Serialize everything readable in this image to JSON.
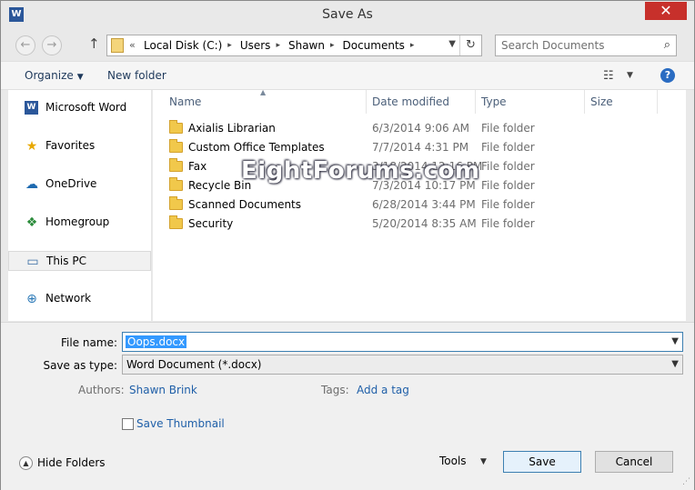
{
  "window": {
    "title": "Save As",
    "app_icon": "W",
    "close_label": "✕"
  },
  "nav": {
    "back_icon": "arrow-left-icon",
    "forward_icon": "arrow-right-icon",
    "up_icon": "arrow-up-icon",
    "crumb_overflow": "«",
    "breadcrumbs": [
      "Local Disk (C:)",
      "Users",
      "Shawn",
      "Documents"
    ],
    "search_placeholder": "Search Documents"
  },
  "toolbar": {
    "organize": "Organize",
    "new_folder": "New folder"
  },
  "sidebar": {
    "items": [
      {
        "label": "Microsoft Word",
        "icon": "word-icon"
      },
      {
        "label": "Favorites",
        "icon": "star-icon"
      },
      {
        "label": "OneDrive",
        "icon": "cloud-icon"
      },
      {
        "label": "Homegroup",
        "icon": "homegroup-icon"
      },
      {
        "label": "This PC",
        "icon": "computer-icon",
        "selected": true
      },
      {
        "label": "Network",
        "icon": "network-icon"
      }
    ]
  },
  "columns": {
    "name": "Name",
    "date": "Date modified",
    "type": "Type",
    "size": "Size"
  },
  "files": [
    {
      "name": "Axialis Librarian",
      "date": "6/3/2014 9:06 AM",
      "type": "File folder"
    },
    {
      "name": "Custom Office Templates",
      "date": "7/7/2014 4:31 PM",
      "type": "File folder"
    },
    {
      "name": "Fax",
      "date": "3/18/2014 12:16 PM",
      "type": "File folder"
    },
    {
      "name": "Recycle Bin",
      "date": "7/3/2014 10:17 PM",
      "type": "File folder"
    },
    {
      "name": "Scanned Documents",
      "date": "6/28/2014 3:44 PM",
      "type": "File folder"
    },
    {
      "name": "Security",
      "date": "5/20/2014 8:35 AM",
      "type": "File folder"
    }
  ],
  "watermark": "EightForums.com",
  "form": {
    "file_name_label": "File name:",
    "file_name_value": "Oops.docx",
    "save_type_label": "Save as type:",
    "save_type_value": "Word Document (*.docx)",
    "authors_label": "Authors:",
    "authors_value": "Shawn Brink",
    "tags_label": "Tags:",
    "tags_value": "Add a tag",
    "thumbnail_label": "Save Thumbnail",
    "thumbnail_checked": false
  },
  "footer": {
    "hide_folders": "Hide Folders",
    "tools": "Tools",
    "save": "Save",
    "cancel": "Cancel"
  },
  "colors": {
    "accent": "#3399ff",
    "link": "#1f5fa8",
    "close": "#c7302b",
    "folder": "#f1c84b"
  }
}
